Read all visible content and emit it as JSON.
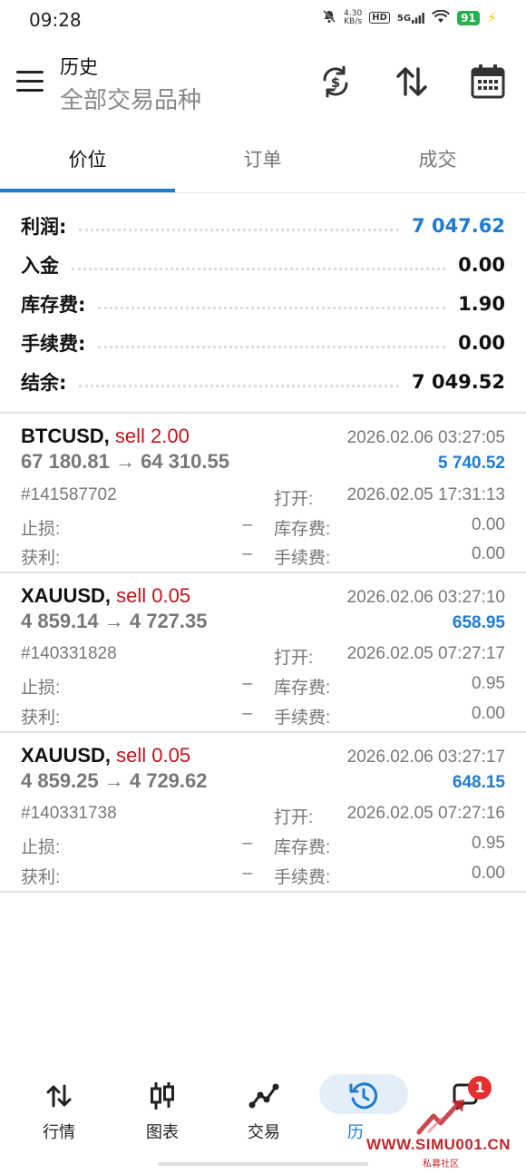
{
  "status_bar": {
    "time": "09:28",
    "net_speed_value": "4.30",
    "net_speed_unit": "KB/s",
    "hd": "HD",
    "signal": "5G",
    "battery": "91"
  },
  "header": {
    "title": "历史",
    "subtitle": "全部交易品种"
  },
  "tabs": [
    {
      "label": "价位",
      "active": true
    },
    {
      "label": "订单",
      "active": false
    },
    {
      "label": "成交",
      "active": false
    }
  ],
  "summary": {
    "profit": {
      "label": "利润:",
      "value": "7 047.62"
    },
    "deposit": {
      "label": "入金",
      "value": "0.00"
    },
    "swap": {
      "label": "库存费:",
      "value": "1.90"
    },
    "commission": {
      "label": "手续费:",
      "value": "0.00"
    },
    "balance": {
      "label": "结余:",
      "value": "7 049.52"
    }
  },
  "labels": {
    "open": "打开:",
    "sl": "止损:",
    "tp": "获利:",
    "swap": "库存费:",
    "commission": "手续费:",
    "dash": "–"
  },
  "trades": [
    {
      "symbol": "BTCUSD,",
      "side": " sell 2.00",
      "prices": "67 180.81 → 64 310.55",
      "close_time": "2026.02.06 03:27:05",
      "profit": "5 740.52",
      "ticket": "#141587702",
      "open_time": "2026.02.05 17:31:13",
      "sl": "–",
      "tp": "–",
      "swap": "0.00",
      "commission": "0.00"
    },
    {
      "symbol": "XAUUSD,",
      "side": " sell 0.05",
      "prices": "4 859.14 → 4 727.35",
      "close_time": "2026.02.06 03:27:10",
      "profit": "658.95",
      "ticket": "#140331828",
      "open_time": "2026.02.05 07:27:17",
      "sl": "–",
      "tp": "–",
      "swap": "0.95",
      "commission": "0.00"
    },
    {
      "symbol": "XAUUSD,",
      "side": " sell 0.05",
      "prices": "4 859.25 → 4 729.62",
      "close_time": "2026.02.06 03:27:17",
      "profit": "648.15",
      "ticket": "#140331738",
      "open_time": "2026.02.05 07:27:16",
      "sl": "–",
      "tp": "–",
      "swap": "0.95",
      "commission": "0.00"
    }
  ],
  "bottom_nav": [
    {
      "label": "行情",
      "icon": "quotes-arrows-icon"
    },
    {
      "label": "图表",
      "icon": "candlestick-chart-icon"
    },
    {
      "label": "交易",
      "icon": "trade-line-icon"
    },
    {
      "label": "历",
      "icon": "history-clock-icon",
      "active": true
    },
    {
      "label": "",
      "icon": "messages-icon",
      "badge": "1"
    }
  ],
  "watermark": {
    "url": "WWW.SIMU001.CN",
    "sub": "私募社区"
  },
  "colors": {
    "accent": "#1e7bd0",
    "sell": "#c0141c",
    "muted": "#777777",
    "badge": "#e52f2f",
    "watermark": "#c1272d"
  }
}
